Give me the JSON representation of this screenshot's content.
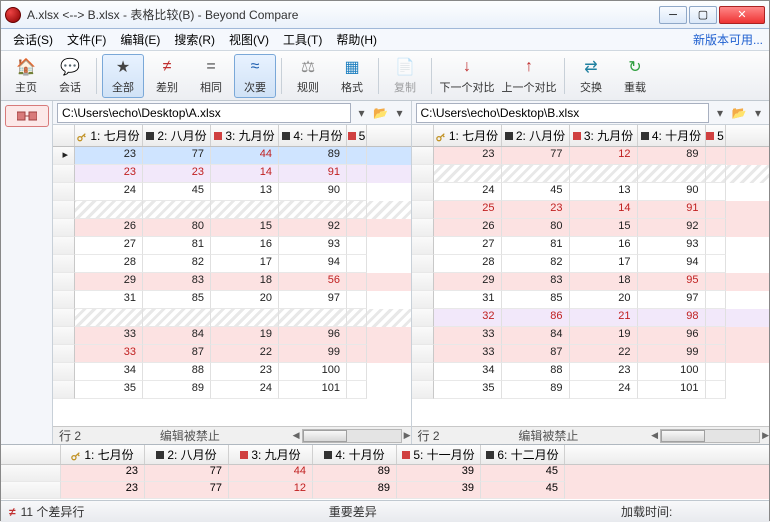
{
  "title": "A.xlsx <--> B.xlsx - 表格比较(B) - Beyond Compare",
  "menu": [
    "会话(S)",
    "文件(F)",
    "编辑(E)",
    "搜索(R)",
    "视图(V)",
    "工具(T)",
    "帮助(H)"
  ],
  "newver": "新版本可用...",
  "toolbar": {
    "home": "主页",
    "session": "会话",
    "all": "全部",
    "diff": "差别",
    "same": "相同",
    "minor": "次要",
    "rules": "规则",
    "format": "格式",
    "copy": "复制",
    "nextdiff": "下一个对比",
    "prevdiff": "上一个对比",
    "swap": "交换",
    "reload": "重载"
  },
  "left": {
    "path": "C:\\Users\\echo\\Desktop\\A.xlsx",
    "headers": [
      {
        "key": true,
        "label": "1: 七月份",
        "sq": null
      },
      {
        "key": false,
        "label": "2: 八月份",
        "sq": "#333"
      },
      {
        "key": false,
        "label": "3: 九月份",
        "sq": "#d04040"
      },
      {
        "key": false,
        "label": "4: 十月份",
        "sq": "#333"
      },
      {
        "key": false,
        "label": "5",
        "sq": "#d04040"
      }
    ],
    "rows": [
      {
        "c": [
          "23",
          "77",
          "44",
          "89"
        ],
        "type": "sel",
        "red": [
          2
        ]
      },
      {
        "c": [
          "23",
          "23",
          "14",
          "91"
        ],
        "type": "diffL",
        "red": [
          0,
          1,
          2,
          3
        ]
      },
      {
        "c": [
          "24",
          "45",
          "13",
          "90"
        ],
        "type": ""
      },
      {
        "c": [
          "",
          "",
          "",
          ""
        ],
        "type": "gap"
      },
      {
        "c": [
          "26",
          "80",
          "15",
          "92"
        ],
        "type": "diff"
      },
      {
        "c": [
          "27",
          "81",
          "16",
          "93"
        ],
        "type": ""
      },
      {
        "c": [
          "28",
          "82",
          "17",
          "94"
        ],
        "type": ""
      },
      {
        "c": [
          "29",
          "83",
          "18",
          "56"
        ],
        "type": "diff",
        "red": [
          3
        ]
      },
      {
        "c": [
          "31",
          "85",
          "20",
          "97"
        ],
        "type": ""
      },
      {
        "c": [
          "",
          "",
          "",
          ""
        ],
        "type": "gap"
      },
      {
        "c": [
          "33",
          "84",
          "19",
          "96"
        ],
        "type": "diff"
      },
      {
        "c": [
          "33",
          "87",
          "22",
          "99"
        ],
        "type": "diff",
        "red": [
          0
        ]
      },
      {
        "c": [
          "34",
          "88",
          "23",
          "100"
        ],
        "type": ""
      },
      {
        "c": [
          "35",
          "89",
          "24",
          "101"
        ],
        "type": ""
      }
    ],
    "status_row": "行 2",
    "status_lock": "编辑被禁止"
  },
  "right": {
    "path": "C:\\Users\\echo\\Desktop\\B.xlsx",
    "headers": [
      {
        "key": true,
        "label": "1: 七月份",
        "sq": null
      },
      {
        "key": false,
        "label": "2: 八月份",
        "sq": "#333"
      },
      {
        "key": false,
        "label": "3: 九月份",
        "sq": "#d04040"
      },
      {
        "key": false,
        "label": "4: 十月份",
        "sq": "#333"
      },
      {
        "key": false,
        "label": "5",
        "sq": "#d04040"
      }
    ],
    "rows": [
      {
        "c": [
          "23",
          "77",
          "12",
          "89"
        ],
        "type": "diff",
        "red": [
          2
        ]
      },
      {
        "c": [
          "",
          "",
          "",
          ""
        ],
        "type": "gap"
      },
      {
        "c": [
          "24",
          "45",
          "13",
          "90"
        ],
        "type": ""
      },
      {
        "c": [
          "25",
          "23",
          "14",
          "91"
        ],
        "type": "diff",
        "red": [
          0,
          1,
          2,
          3
        ]
      },
      {
        "c": [
          "26",
          "80",
          "15",
          "92"
        ],
        "type": "diff"
      },
      {
        "c": [
          "27",
          "81",
          "16",
          "93"
        ],
        "type": ""
      },
      {
        "c": [
          "28",
          "82",
          "17",
          "94"
        ],
        "type": ""
      },
      {
        "c": [
          "29",
          "83",
          "18",
          "95"
        ],
        "type": "diff",
        "red": [
          3
        ]
      },
      {
        "c": [
          "31",
          "85",
          "20",
          "97"
        ],
        "type": ""
      },
      {
        "c": [
          "32",
          "86",
          "21",
          "98"
        ],
        "type": "diffL",
        "red": [
          0,
          1,
          2,
          3
        ]
      },
      {
        "c": [
          "33",
          "84",
          "19",
          "96"
        ],
        "type": "diff"
      },
      {
        "c": [
          "33",
          "87",
          "22",
          "99"
        ],
        "type": "diff"
      },
      {
        "c": [
          "34",
          "88",
          "23",
          "100"
        ],
        "type": ""
      },
      {
        "c": [
          "35",
          "89",
          "24",
          "101"
        ],
        "type": ""
      }
    ],
    "status_row": "行 2",
    "status_lock": "编辑被禁止"
  },
  "detail": {
    "headers": [
      {
        "key": true,
        "label": "1: 七月份"
      },
      {
        "sq": "#333",
        "label": "2: 八月份"
      },
      {
        "sq": "#d04040",
        "label": "3: 九月份"
      },
      {
        "sq": "#333",
        "label": "4: 十月份"
      },
      {
        "sq": "#d04040",
        "label": "5: 十一月份"
      },
      {
        "sq": "#333",
        "label": "6: 十二月份"
      }
    ],
    "rows": [
      {
        "c": [
          "23",
          "77",
          "44",
          "89",
          "39",
          "45"
        ],
        "type": "diff",
        "red": [
          2
        ]
      },
      {
        "c": [
          "23",
          "77",
          "12",
          "89",
          "39",
          "45"
        ],
        "type": "diff",
        "red": [
          2
        ]
      }
    ]
  },
  "status": {
    "diffcount": "11 个差异行",
    "center": "重要差异",
    "loadtime": "加载时间:"
  },
  "icons": {
    "home": "🏠",
    "session": "💬",
    "star": "★",
    "neq": "≠",
    "eq": "=",
    "approx": "≈",
    "rules": "⚖",
    "format": "▦",
    "copy": "📄",
    "down": "↓",
    "up": "↑",
    "swap": "⇄",
    "reload": "↻",
    "folder": "📂",
    "arrow": "▾"
  }
}
